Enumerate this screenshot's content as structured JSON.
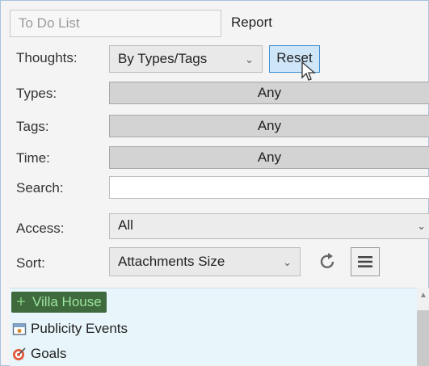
{
  "tabs": {
    "todo": "To Do List",
    "report": "Report"
  },
  "filters": {
    "thoughts": {
      "label": "Thoughts:",
      "value": "By Types/Tags"
    },
    "reset_label": "Reset",
    "types": {
      "label": "Types:",
      "value": "Any"
    },
    "tags": {
      "label": "Tags:",
      "value": "Any"
    },
    "time": {
      "label": "Time:",
      "value": "Any"
    },
    "search": {
      "label": "Search:",
      "value": ""
    },
    "access": {
      "label": "Access:",
      "value": "All"
    },
    "sort": {
      "label": "Sort:",
      "value": "Attachments Size"
    }
  },
  "list": [
    {
      "label": "Villa House",
      "icon": "plus-icon"
    },
    {
      "label": "Publicity Events",
      "icon": "calendar-icon"
    },
    {
      "label": "Goals",
      "icon": "target-icon"
    }
  ],
  "colors": {
    "selected_bg": "#3e6a3e",
    "selected_text": "#9fe59f",
    "list_bg": "#e8f6fb",
    "reset_bg": "#cfe6f9"
  }
}
